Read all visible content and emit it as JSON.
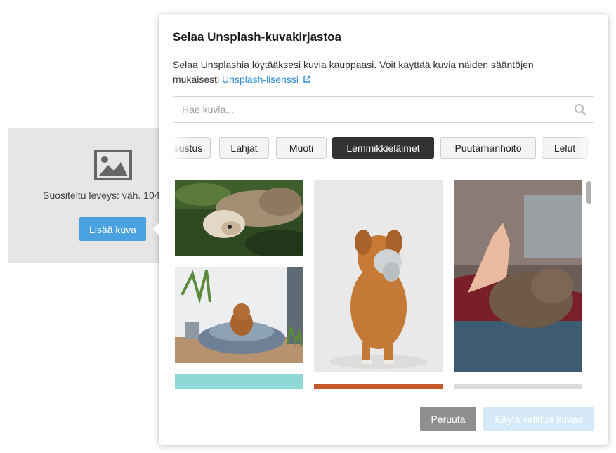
{
  "placeholder": {
    "icon": "image-icon",
    "hint": "Suositeltu leveys: väh. 104",
    "add_label": "Lisää kuva"
  },
  "modal": {
    "title": "Selaa Unsplash-kuvakirjastoa",
    "description": "Selaa Unsplashia löytääksesi kuvia kauppaasi. Voit käyttää kuvia näiden sääntöjen mukaisesti",
    "license_link": "Unsplash-lisenssi",
    "license_icon": "external-link-icon"
  },
  "search": {
    "placeholder": "Hae kuvia...",
    "value": "",
    "icon": "search-icon"
  },
  "categories": [
    {
      "label": "sustus",
      "active": false
    },
    {
      "label": "Lahjat",
      "active": false
    },
    {
      "label": "Muoti",
      "active": false
    },
    {
      "label": "Lemmikkieläimet",
      "active": true
    },
    {
      "label": "Puutarhanhoito",
      "active": false
    },
    {
      "label": "Lelut",
      "active": false
    }
  ],
  "photos": [
    {
      "subject": "cat and dog lying on grass"
    },
    {
      "subject": "dog holding toy"
    },
    {
      "subject": "high five with cat paw"
    },
    {
      "subject": "dog in pet bed"
    },
    {
      "subject": "partial photo"
    },
    {
      "subject": "partial photo"
    },
    {
      "subject": "partial photo"
    }
  ],
  "footer": {
    "cancel_label": "Peruuta",
    "apply_label": "Käytä valittua kuvaa"
  },
  "colors": {
    "accent": "#4aa3e0",
    "link": "#2f8fd6",
    "active_chip": "#333333",
    "disabled_primary": "#d6e9f8"
  }
}
